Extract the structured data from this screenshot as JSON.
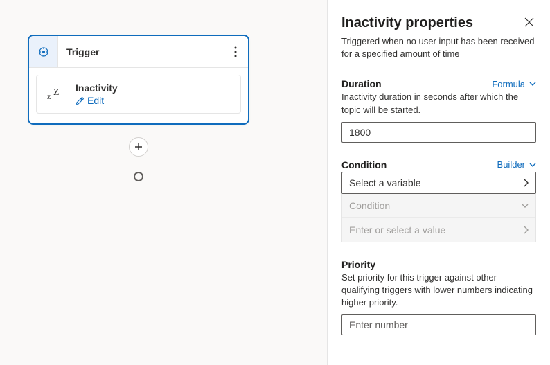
{
  "canvas": {
    "trigger_label": "Trigger",
    "inactivity": {
      "title": "Inactivity",
      "edit_label": "Edit"
    }
  },
  "panel": {
    "title": "Inactivity properties",
    "description": "Triggered when no user input has been received for a specified amount of time",
    "duration": {
      "label": "Duration",
      "mode": "Formula",
      "help": "Inactivity duration in seconds after which the topic will be started.",
      "value": "1800"
    },
    "condition": {
      "label": "Condition",
      "mode": "Builder",
      "variable_placeholder": "Select a variable",
      "operator_placeholder": "Condition",
      "value_placeholder": "Enter or select a value"
    },
    "priority": {
      "label": "Priority",
      "help": "Set priority for this trigger against other qualifying triggers with lower numbers indicating higher priority.",
      "placeholder": "Enter number"
    }
  }
}
